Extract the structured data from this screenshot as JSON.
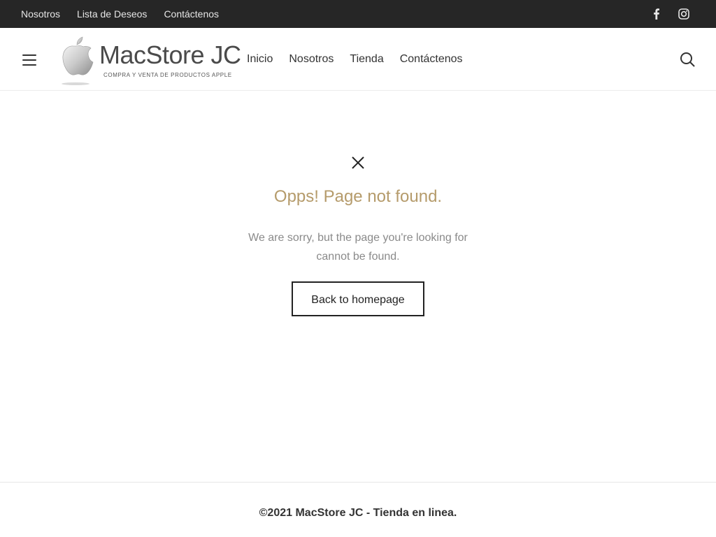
{
  "topbar": {
    "links": [
      "Nosotros",
      "Lista de Deseos",
      "Contáctenos"
    ],
    "social_icons": [
      "facebook-icon",
      "instagram-icon"
    ]
  },
  "header": {
    "logo": {
      "brand": "MacStore JC",
      "tagline": "COMPRA Y VENTA DE PRODUCTOS APPLE"
    },
    "nav": [
      "Inicio",
      "Nosotros",
      "Tienda",
      "Contáctenos"
    ],
    "icons": [
      "hamburger-menu-icon",
      "search-icon"
    ]
  },
  "notfound": {
    "icon": "close-icon",
    "title": "Opps! Page not found.",
    "message": "We are sorry, but the page you're looking for cannot be found.",
    "button_label": "Back to homepage"
  },
  "footer": {
    "copyright": "©2021 MacStore JC - Tienda en linea."
  },
  "colors": {
    "topbar_bg": "#262626",
    "accent": "#b59b6b",
    "text": "#333333",
    "muted": "#8a8a8a"
  }
}
